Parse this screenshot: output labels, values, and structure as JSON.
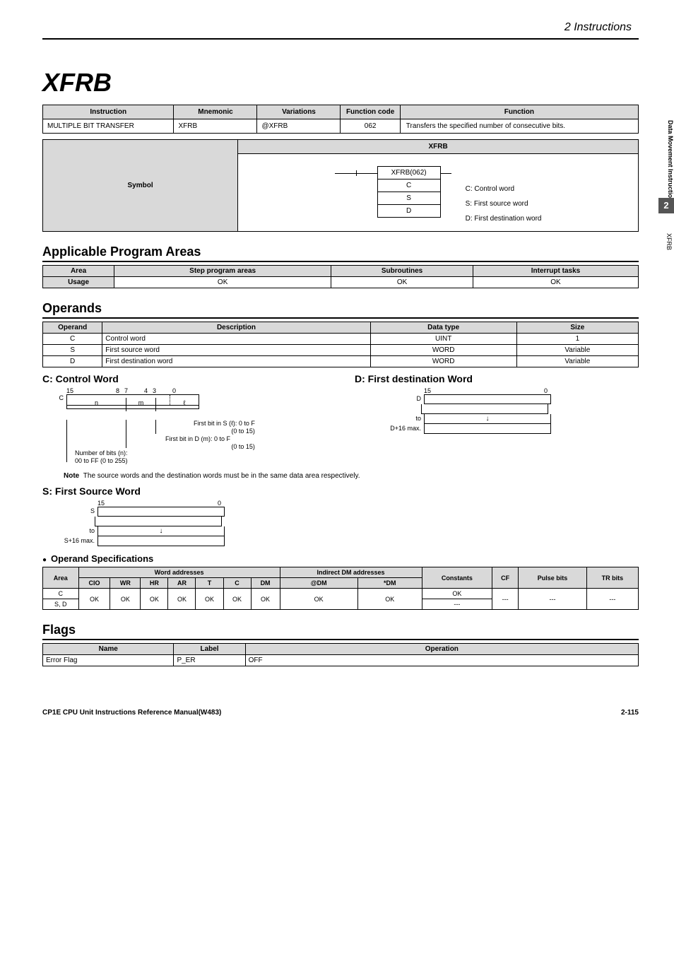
{
  "header": {
    "section": "2   Instructions"
  },
  "title": "XFRB",
  "side": {
    "category": "Data Movement Instructions",
    "num": "2",
    "code": "XFRB"
  },
  "main_table": {
    "headers": [
      "Instruction",
      "Mnemonic",
      "Variations",
      "Function code",
      "Function"
    ],
    "row": {
      "instruction": "MULTIPLE BIT TRANSFER",
      "mnemonic": "XFRB",
      "variations": "@XFRB",
      "code": "062",
      "function": "Transfers the specified number of consecutive bits."
    }
  },
  "symbol": {
    "title_header": "XFRB",
    "row_header": "Symbol",
    "ladder": {
      "top": "XFRB(062)",
      "c": "C",
      "s": "S",
      "d": "D"
    },
    "labels": {
      "c": "C: Control word",
      "s": "S: First source word",
      "d": "D: First destination word"
    }
  },
  "applicable": {
    "title": "Applicable Program Areas",
    "headers": [
      "Area",
      "Step program areas",
      "Subroutines",
      "Interrupt tasks"
    ],
    "row": [
      "Usage",
      "OK",
      "OK",
      "OK"
    ]
  },
  "operands": {
    "title": "Operands",
    "headers": [
      "Operand",
      "Description",
      "Data type",
      "Size"
    ],
    "rows": [
      [
        "C",
        "Control word",
        "UINT",
        "1"
      ],
      [
        "S",
        "First source word",
        "WORD",
        "Variable"
      ],
      [
        "D",
        "First destination word",
        "WORD",
        "Variable"
      ]
    ]
  },
  "cword": {
    "title": "C: Control Word",
    "bits": [
      "15",
      "8",
      "7",
      "4",
      "3",
      "0"
    ],
    "label": "C",
    "segs": [
      "n",
      "m",
      "ℓ"
    ],
    "lines": [
      "First bit in S (ℓ): 0 to F",
      "(0 to 15)",
      "First bit in D (m): 0 to F",
      "(0 to 15)",
      "Number of bits (n):",
      "00 to FF (0 to 255)"
    ]
  },
  "dword": {
    "title": "D: First destination Word",
    "bits": [
      "15",
      "0"
    ],
    "label_top": "D",
    "label_mid": "to",
    "label_bot": "D+16 max."
  },
  "note": "The source words and the destination words must be in the same data area respectively.",
  "note_label": "Note",
  "sword": {
    "title": "S: First Source Word",
    "bits": [
      "15",
      "0"
    ],
    "label_top": "S",
    "label_mid": "to",
    "label_bot": "S+16 max."
  },
  "opspec": {
    "title": "Operand Specifications",
    "group_headers": [
      "Area",
      "Word addresses",
      "Indirect DM addresses",
      "Constants",
      "CF",
      "Pulse bits",
      "TR bits"
    ],
    "sub_headers": [
      "CIO",
      "WR",
      "HR",
      "AR",
      "T",
      "C",
      "DM",
      "@DM",
      "*DM"
    ],
    "rows": [
      {
        "area": "C",
        "constants": "OK"
      },
      {
        "area": "S, D",
        "constants": "---"
      }
    ],
    "shared": {
      "word": "OK",
      "indirect": "OK",
      "cf": "---",
      "pulse": "---",
      "tr": "---"
    }
  },
  "flags": {
    "title": "Flags",
    "headers": [
      "Name",
      "Label",
      "Operation"
    ],
    "row": [
      "Error Flag",
      "P_ER",
      "OFF"
    ]
  },
  "footer": {
    "left": "CP1E CPU Unit Instructions Reference Manual(W483)",
    "right": "2-115"
  }
}
